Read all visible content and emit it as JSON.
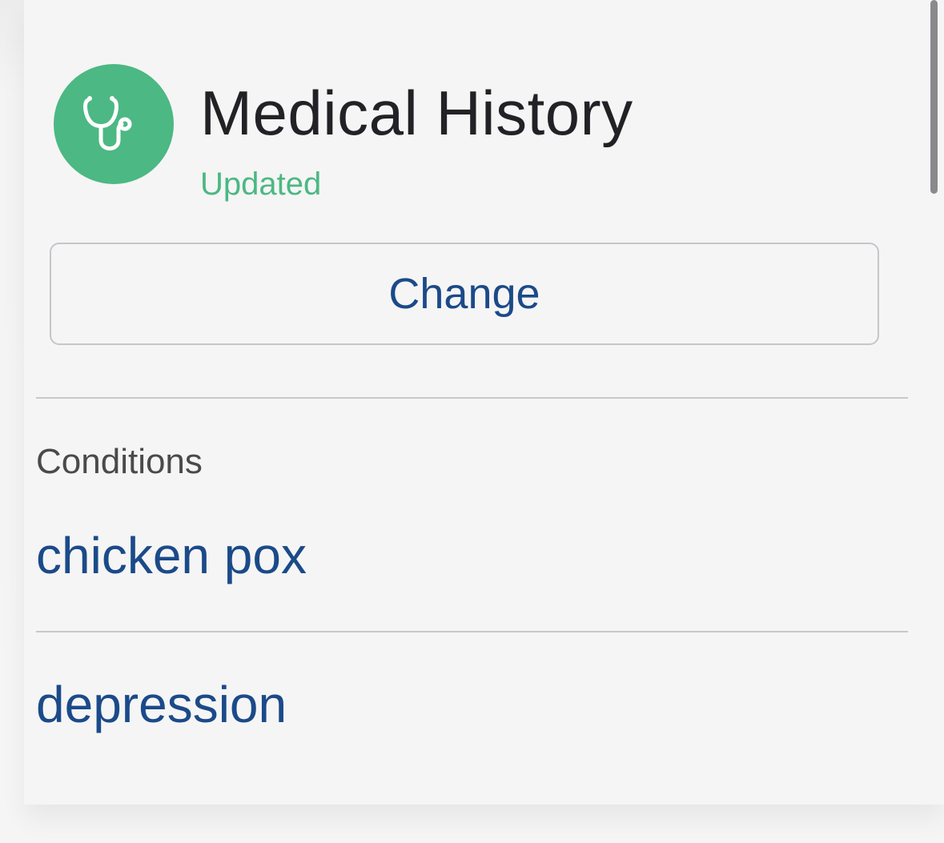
{
  "header": {
    "title": "Medical History",
    "status": "Updated",
    "icon": "stethoscope-icon",
    "accent_color": "#4cb883"
  },
  "actions": {
    "change_label": "Change"
  },
  "conditions": {
    "label": "Conditions",
    "items": [
      {
        "name": "chicken pox"
      },
      {
        "name": "depression"
      }
    ]
  },
  "colors": {
    "link": "#1b4a89",
    "divider": "#c8c9ce"
  }
}
